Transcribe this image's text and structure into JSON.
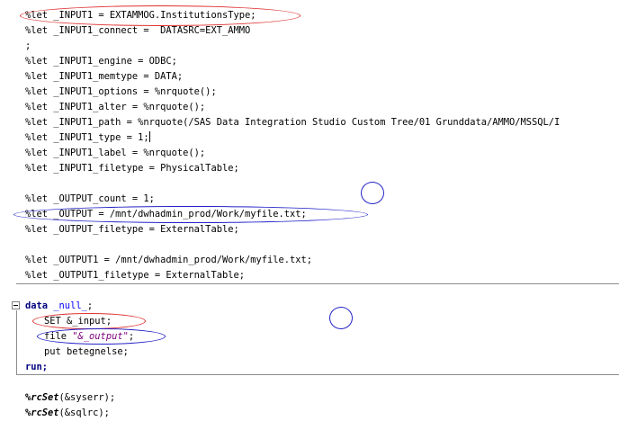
{
  "lines": [
    "%let _INPUT1 = EXTAMMOG.InstitutionsType;",
    "%let _INPUT1_connect =  DATASRC=EXT_AMMO",
    ";",
    "%let _INPUT1_engine = ODBC;",
    "%let _INPUT1_memtype = DATA;",
    "%let _INPUT1_options = %nrquote();",
    "%let _INPUT1_alter = %nrquote();",
    "%let _INPUT1_path = %nrquote(/SAS Data Integration Studio Custom Tree/01 Grunddata/AMMO/MSSQL/I",
    "%let _INPUT1_type = 1;",
    "%let _INPUT1_label = %nrquote();",
    "%let _INPUT1_filetype = PhysicalTable;",
    "",
    "%let _OUTPUT_count = 1;",
    "%let _OUTPUT = /mnt/dwhadmin_prod/Work/myfile.txt;",
    "%let _OUTPUT_filetype = ExternalTable;",
    "",
    "%let _OUTPUT1 = /mnt/dwhadmin_prod/Work/myfile.txt;",
    "%let _OUTPUT1_filetype = ExternalTable;"
  ],
  "datastep": {
    "data_kw": "data",
    "data_name": "_null_",
    "data_semi": ";",
    "set_stmt": "SET &_input;",
    "file_kw": "file ",
    "file_str": "\"&_output\"",
    "file_semi": ";",
    "put_stmt": "put betegnelse;",
    "run_kw": "run;"
  },
  "footer": {
    "rcset_1_mac": "%rcSet",
    "rcset_1_args": "(&syserr);",
    "rcset_2_mac": "%rcSet",
    "rcset_2_args": "(&sqlrc);"
  }
}
